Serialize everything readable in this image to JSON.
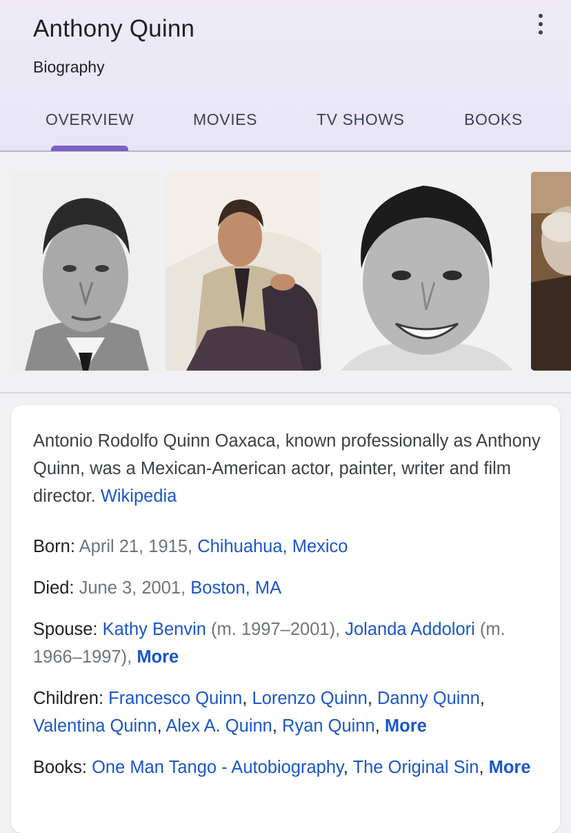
{
  "header": {
    "title": "Anthony Quinn",
    "subtitle": "Biography",
    "tabs": [
      {
        "label": "OVERVIEW",
        "active": true
      },
      {
        "label": "MOVIES",
        "active": false
      },
      {
        "label": "TV SHOWS",
        "active": false
      },
      {
        "label": "BOOKS",
        "active": false
      }
    ],
    "accent_color": "#7b5fc4"
  },
  "images": [
    {
      "name": "portrait-1",
      "style": "black-and-white"
    },
    {
      "name": "portrait-2",
      "style": "color"
    },
    {
      "name": "portrait-3",
      "style": "black-and-white"
    },
    {
      "name": "portrait-4",
      "style": "color, partially visible"
    }
  ],
  "description": {
    "text": "Antonio Rodolfo Quinn Oaxaca, known professionally as Anthony Quinn, was a Mexican-American actor, painter, writer and film director.",
    "source_link": "Wikipedia"
  },
  "facts": {
    "born": {
      "label": "Born:",
      "date": "April 21, 1915,",
      "place": "Chihuahua, Mexico"
    },
    "died": {
      "label": "Died:",
      "date": "June 3, 2001,",
      "place": "Boston, MA"
    },
    "spouse": {
      "label": "Spouse:",
      "items": [
        {
          "name": "Kathy Benvin",
          "years": "(m. 1997–2001),"
        },
        {
          "name": "Jolanda Addolori",
          "years": "(m. 1966–1997),"
        }
      ],
      "more": "More"
    },
    "children": {
      "label": "Children:",
      "items": [
        "Francesco Quinn",
        "Lorenzo Quinn",
        "Danny Quinn",
        "Valentina Quinn",
        "Alex A. Quinn",
        "Ryan Quinn"
      ],
      "more": "More"
    },
    "books": {
      "label": "Books:",
      "items": [
        "One Man Tango - Autobiography",
        "The Original Sin"
      ],
      "more": "More"
    }
  },
  "link_color": "#1a57c9"
}
